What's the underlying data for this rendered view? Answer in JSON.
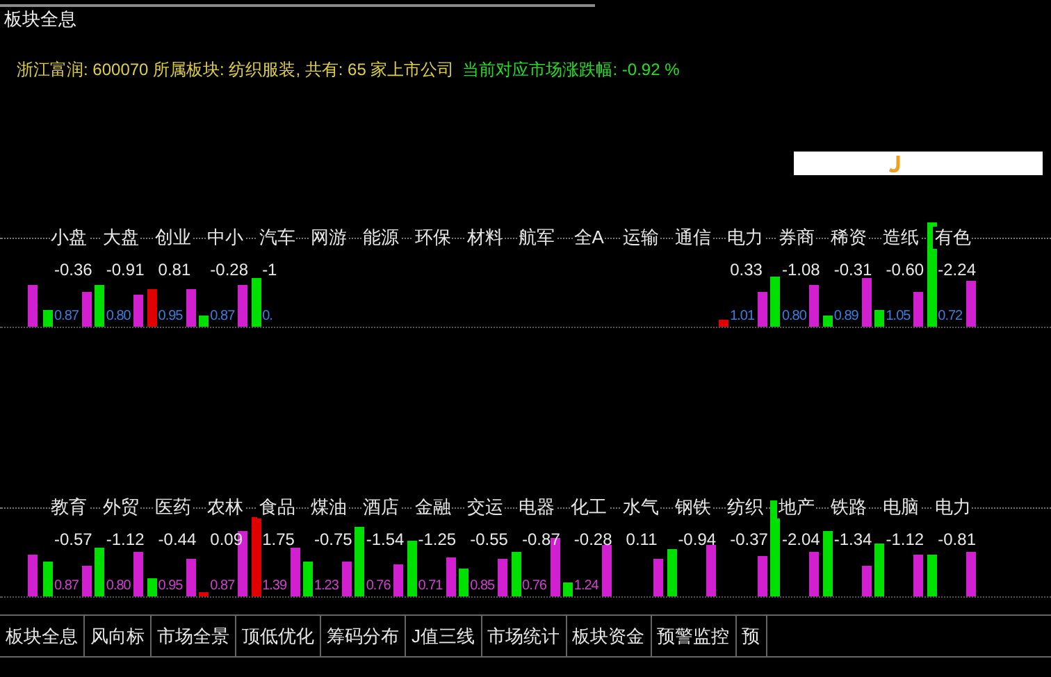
{
  "title": "板块全息",
  "info": {
    "stock": "浙江富润: 600070 所属板块: 纺织服装, 共有: 65 家上市公司",
    "market": "当前对应市场涨跌幅: -0.92 %"
  },
  "rows": [
    {
      "columns": [
        {
          "label": "小盘",
          "change": "-0.36",
          "change_bar": {
            "color": "#00e000"
          },
          "ratio": "0.87"
        },
        {
          "label": "大盘",
          "change": "-0.91",
          "change_bar": {
            "color": "#00e000"
          },
          "ratio": "0.80"
        },
        {
          "label": "创业",
          "change": "0.81",
          "change_bar": {
            "color": "#e00000"
          },
          "ratio": "0.95"
        },
        {
          "label": "中小",
          "change": "-0.28",
          "change_bar": {
            "color": "#00e000"
          },
          "ratio": "0.87"
        },
        {
          "label": "汽车",
          "change": "-1",
          "change_bar": {
            "color": "#00e000"
          },
          "ratio": "0."
        },
        {
          "label": "网游"
        },
        {
          "label": "能源"
        },
        {
          "label": "环保"
        },
        {
          "label": "材料"
        },
        {
          "label": "航军"
        },
        {
          "label": "全A"
        },
        {
          "label": "运输"
        },
        {
          "label": "通信"
        },
        {
          "label": "电力",
          "change": "0.33",
          "change_bar": {
            "color": "#e00000"
          },
          "ratio": "1.01"
        },
        {
          "label": "券商",
          "change": "-1.08",
          "change_bar": {
            "color": "#00e000"
          },
          "ratio": "0.80"
        },
        {
          "label": "稀资",
          "change": "-0.31",
          "change_bar": {
            "color": "#00e000"
          },
          "ratio": "0.89"
        },
        {
          "label": "造纸",
          "change": "-0.60",
          "change_bar": {
            "color": "#00e000"
          },
          "ratio": "1.05"
        },
        {
          "label": "有色",
          "change": "-2.24",
          "change_bar": {
            "color": "#00e000"
          },
          "ratio": "0.72"
        }
      ]
    },
    {
      "columns": [
        {
          "label": "教育",
          "change": "-0.57",
          "change_bar": {
            "color": "#00e000"
          },
          "ratio": "0.87"
        },
        {
          "label": "外贸",
          "change": "-1.12",
          "change_bar": {
            "color": "#00e000"
          },
          "ratio": "0.80"
        },
        {
          "label": "医药",
          "change": "-0.44",
          "change_bar": {
            "color": "#00e000"
          },
          "ratio": "0.95"
        },
        {
          "label": "农林",
          "change": "0.09",
          "change_bar": {
            "color": "#e00000"
          },
          "ratio": "0.87"
        },
        {
          "label": "食品",
          "change": "1.75",
          "change_bar": {
            "color": "#e00000"
          },
          "ratio": "1.39"
        },
        {
          "label": "煤油",
          "change": "-0.75",
          "change_bar": {
            "color": "#00e000"
          },
          "ratio": "1.23"
        },
        {
          "label": "酒店",
          "change": "-1.54",
          "change_bar": {
            "color": "#00e000"
          },
          "ratio": "0.76"
        },
        {
          "label": "金融",
          "change": "-1.25",
          "change_bar": {
            "color": "#00e000"
          },
          "ratio": "0.71"
        },
        {
          "label": "交运",
          "change": "-0.55",
          "change_bar": {
            "color": "#00e000"
          },
          "ratio": "0.85"
        },
        {
          "label": "电器",
          "change": "-0.87",
          "change_bar": {
            "color": "#00e000"
          },
          "ratio": "0.76"
        },
        {
          "label": "化工",
          "change": "-0.28",
          "change_bar": {
            "color": "#00e000"
          },
          "ratio": "1.24"
        },
        {
          "label": "水气",
          "change": "0.11"
        },
        {
          "label": "钢铁",
          "change": "-0.94",
          "change_bar": {
            "color": "#00e000"
          }
        },
        {
          "label": "纺织",
          "change": "-0.37"
        },
        {
          "label": "地产",
          "change": "-2.04",
          "change_bar": {
            "color": "#00e000"
          }
        },
        {
          "label": "铁路",
          "change": "-1.34",
          "change_bar": {
            "color": "#00e000"
          }
        },
        {
          "label": "电脑",
          "change": "-1.12",
          "change_bar": {
            "color": "#00e000"
          }
        },
        {
          "label": "电力",
          "change": "-0.81",
          "change_bar": {
            "color": "#00e000"
          }
        }
      ]
    }
  ],
  "tabs": [
    "板块全息",
    "风向标",
    "市场全景",
    "顶低优化",
    "筹码分布",
    "J值三线",
    "市场统计",
    "板块资金",
    "预警监控",
    "预"
  ]
}
